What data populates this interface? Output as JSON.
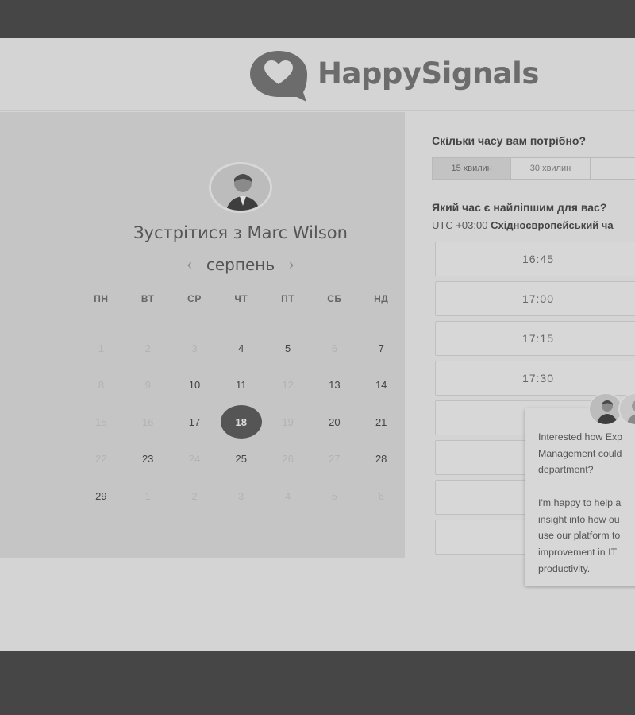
{
  "brand": {
    "name": "HappySignals",
    "logo_icon": "heart-speech-bubble-icon"
  },
  "calendar": {
    "title": "Зустрітися з Marc Wilson",
    "month": "серпень",
    "prev_icon": "chevron-left-icon",
    "next_icon": "chevron-right-icon",
    "weekdays": [
      "пн",
      "вт",
      "ср",
      "чт",
      "пт",
      "сб",
      "нд"
    ],
    "days": [
      {
        "label": "1",
        "state": "muted"
      },
      {
        "label": "2",
        "state": "muted"
      },
      {
        "label": "3",
        "state": "muted"
      },
      {
        "label": "4",
        "state": "available"
      },
      {
        "label": "5",
        "state": "available"
      },
      {
        "label": "6",
        "state": "muted"
      },
      {
        "label": "7",
        "state": "available"
      },
      {
        "label": "8",
        "state": "muted"
      },
      {
        "label": "9",
        "state": "muted"
      },
      {
        "label": "10",
        "state": "available"
      },
      {
        "label": "11",
        "state": "available"
      },
      {
        "label": "12",
        "state": "muted"
      },
      {
        "label": "13",
        "state": "available"
      },
      {
        "label": "14",
        "state": "available"
      },
      {
        "label": "15",
        "state": "muted"
      },
      {
        "label": "16",
        "state": "muted"
      },
      {
        "label": "17",
        "state": "available"
      },
      {
        "label": "18",
        "state": "selected"
      },
      {
        "label": "19",
        "state": "muted"
      },
      {
        "label": "20",
        "state": "available"
      },
      {
        "label": "21",
        "state": "available"
      },
      {
        "label": "22",
        "state": "muted"
      },
      {
        "label": "23",
        "state": "available"
      },
      {
        "label": "24",
        "state": "muted"
      },
      {
        "label": "25",
        "state": "available"
      },
      {
        "label": "26",
        "state": "muted"
      },
      {
        "label": "27",
        "state": "muted"
      },
      {
        "label": "28",
        "state": "available"
      },
      {
        "label": "29",
        "state": "available"
      },
      {
        "label": "1",
        "state": "muted"
      },
      {
        "label": "2",
        "state": "muted"
      },
      {
        "label": "3",
        "state": "muted"
      },
      {
        "label": "4",
        "state": "muted"
      },
      {
        "label": "5",
        "state": "muted"
      },
      {
        "label": "6",
        "state": "muted"
      }
    ]
  },
  "booking": {
    "duration_question": "Скільки часу вам потрібно?",
    "durations": [
      {
        "label": "15 хвилин",
        "selected": true
      },
      {
        "label": "30 хвилин",
        "selected": false
      },
      {
        "label": "",
        "selected": false
      }
    ],
    "time_question": "Який час є найліпшим для вас?",
    "timezone_offset": "UTC +03:00",
    "timezone_name": "Східноєвропейський ча",
    "slots": [
      "16:45",
      "17:00",
      "17:15",
      "17:30",
      "",
      "",
      "",
      ""
    ]
  },
  "chat": {
    "lines_p1": [
      "Interested how Exp",
      "Management could",
      "department?"
    ],
    "lines_p2": [
      "I'm happy to help a",
      "insight into how ou",
      "use our platform to",
      "improvement in IT",
      "productivity."
    ]
  }
}
